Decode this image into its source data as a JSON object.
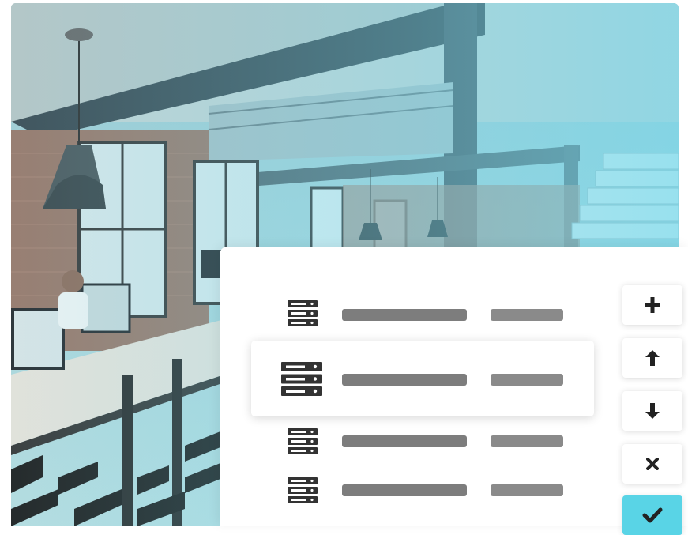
{
  "photo": {
    "description_icon": "office-photo"
  },
  "server_list": {
    "rows": [
      {
        "icon": "server-icon",
        "highlighted": false
      },
      {
        "icon": "server-icon",
        "highlighted": true
      },
      {
        "icon": "server-icon",
        "highlighted": false
      },
      {
        "icon": "server-icon",
        "highlighted": false
      }
    ]
  },
  "actions": [
    {
      "name": "add",
      "icon": "plus-icon"
    },
    {
      "name": "move-up",
      "icon": "arrow-up-icon"
    },
    {
      "name": "move-down",
      "icon": "arrow-down-icon"
    },
    {
      "name": "remove",
      "icon": "close-icon"
    },
    {
      "name": "confirm",
      "icon": "check-icon"
    }
  ],
  "colors": {
    "accent": "#59d4e6",
    "placeholder_bar": "#7d7d7d",
    "icon": "#333333"
  }
}
